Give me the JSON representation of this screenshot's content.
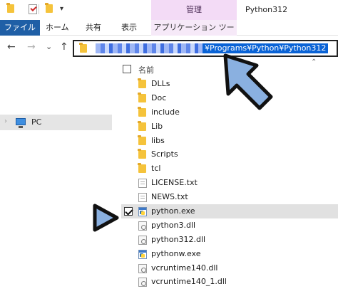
{
  "titlebar": {
    "manage_tab": "管理",
    "window_title": "Python312",
    "qa_menu_arrow": "▾"
  },
  "ribbon": {
    "tabs": [
      "ファイル",
      "ホーム",
      "共有",
      "表示",
      "アプリケーション ツール"
    ]
  },
  "nav": {
    "back": "←",
    "forward": "→",
    "recent": "⌄",
    "up": "↑"
  },
  "address": {
    "visible_path": "¥Programs¥Python¥Python312"
  },
  "columns": {
    "name_header": "名前",
    "sort_caret": "⌃"
  },
  "sidebar": {
    "items": [
      {
        "label": "PC",
        "icon": "pc-icon",
        "expander": "›"
      }
    ]
  },
  "files": [
    {
      "name": "DLLs",
      "type": "folder",
      "selected": false
    },
    {
      "name": "Doc",
      "type": "folder",
      "selected": false
    },
    {
      "name": "include",
      "type": "folder",
      "selected": false
    },
    {
      "name": "Lib",
      "type": "folder",
      "selected": false
    },
    {
      "name": "libs",
      "type": "folder",
      "selected": false
    },
    {
      "name": "Scripts",
      "type": "folder",
      "selected": false
    },
    {
      "name": "tcl",
      "type": "folder",
      "selected": false
    },
    {
      "name": "LICENSE.txt",
      "type": "text",
      "selected": false
    },
    {
      "name": "NEWS.txt",
      "type": "text",
      "selected": false
    },
    {
      "name": "python.exe",
      "type": "exe",
      "selected": true
    },
    {
      "name": "python3.dll",
      "type": "dll",
      "selected": false
    },
    {
      "name": "python312.dll",
      "type": "dll",
      "selected": false
    },
    {
      "name": "pythonw.exe",
      "type": "exe",
      "selected": false
    },
    {
      "name": "vcruntime140.dll",
      "type": "dll",
      "selected": false
    },
    {
      "name": "vcruntime140_1.dll",
      "type": "dll",
      "selected": false
    }
  ],
  "colors": {
    "file_tab": "#1f5fa6",
    "manage_tab": "#f3dbf6",
    "selection_highlight": "#0a63d6",
    "annotation_fill": "#8ab0e0",
    "annotation_stroke": "#111111"
  },
  "annotations": [
    {
      "kind": "arrow",
      "icon": "pointer-arrow-icon",
      "points_to": "address-bar"
    },
    {
      "kind": "triangle",
      "icon": "play-triangle-icon",
      "points_to": "python.exe"
    }
  ]
}
